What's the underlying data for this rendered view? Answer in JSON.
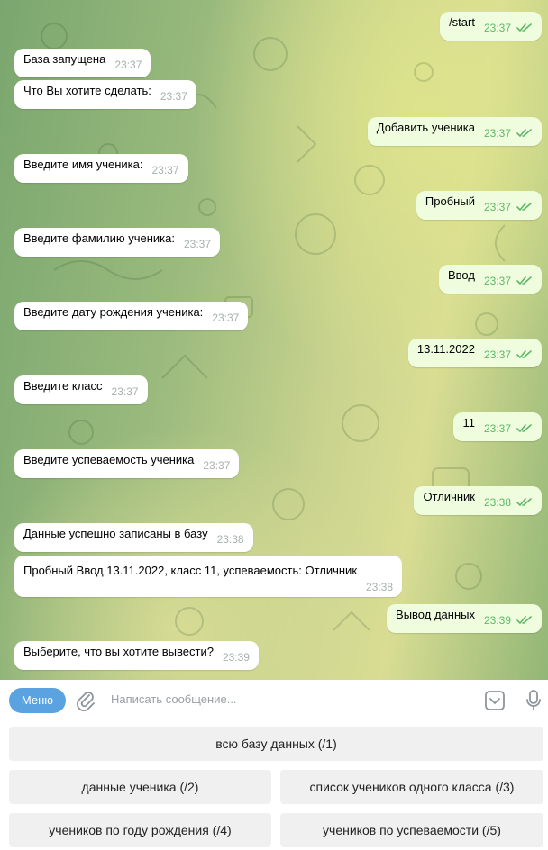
{
  "messages": [
    {
      "dir": "out",
      "text": "/start",
      "time": "23:37"
    },
    {
      "dir": "in",
      "text": "База запущена",
      "time": "23:37"
    },
    {
      "dir": "in",
      "text": "Что Вы хотите сделать:",
      "time": "23:37"
    },
    {
      "dir": "out",
      "text": "Добавить ученика",
      "time": "23:37"
    },
    {
      "dir": "in",
      "text": "Введите имя ученика:",
      "time": "23:37"
    },
    {
      "dir": "out",
      "text": "Пробный",
      "time": "23:37"
    },
    {
      "dir": "in",
      "text": "Введите фамилию ученика:",
      "time": "23:37"
    },
    {
      "dir": "out",
      "text": "Ввод",
      "time": "23:37"
    },
    {
      "dir": "in",
      "text": "Введите дату рождения ученика:",
      "time": "23:37"
    },
    {
      "dir": "out",
      "text": "13.11.2022",
      "time": "23:37"
    },
    {
      "dir": "in",
      "text": "Введите класс",
      "time": "23:37"
    },
    {
      "dir": "out",
      "text": "11",
      "time": "23:37"
    },
    {
      "dir": "in",
      "text": "Введите успеваемость ученика",
      "time": "23:37"
    },
    {
      "dir": "out",
      "text": "Отличник",
      "time": "23:38"
    },
    {
      "dir": "in",
      "text": "Данные успешно записаны в базу",
      "time": "23:38"
    },
    {
      "dir": "in",
      "text": "Пробный Ввод 13.11.2022, класс 11, успеваемость: Отличник",
      "time": "23:38"
    },
    {
      "dir": "out",
      "text": "Вывод данных",
      "time": "23:39"
    },
    {
      "dir": "in",
      "text": "Выберите, что вы хотите вывести?",
      "time": "23:39"
    }
  ],
  "composer": {
    "menu_label": "Меню",
    "placeholder": "Написать сообщение..."
  },
  "keyboard": {
    "row1": [
      "всю базу данных (/1)"
    ],
    "row2": [
      "данные ученика (/2)",
      "список учеников одного класса (/3)"
    ],
    "row3": [
      "учеников по году рождения (/4)",
      "учеников по успеваемости (/5)"
    ]
  },
  "colors": {
    "outgoing_bubble": "#effdde",
    "incoming_bubble": "#ffffff",
    "read_ticks": "#5fb76a",
    "menu_button": "#5aa3e0"
  },
  "icons": [
    "attach-icon",
    "keyboard-icon",
    "microphone-icon",
    "double-check-icon"
  ]
}
